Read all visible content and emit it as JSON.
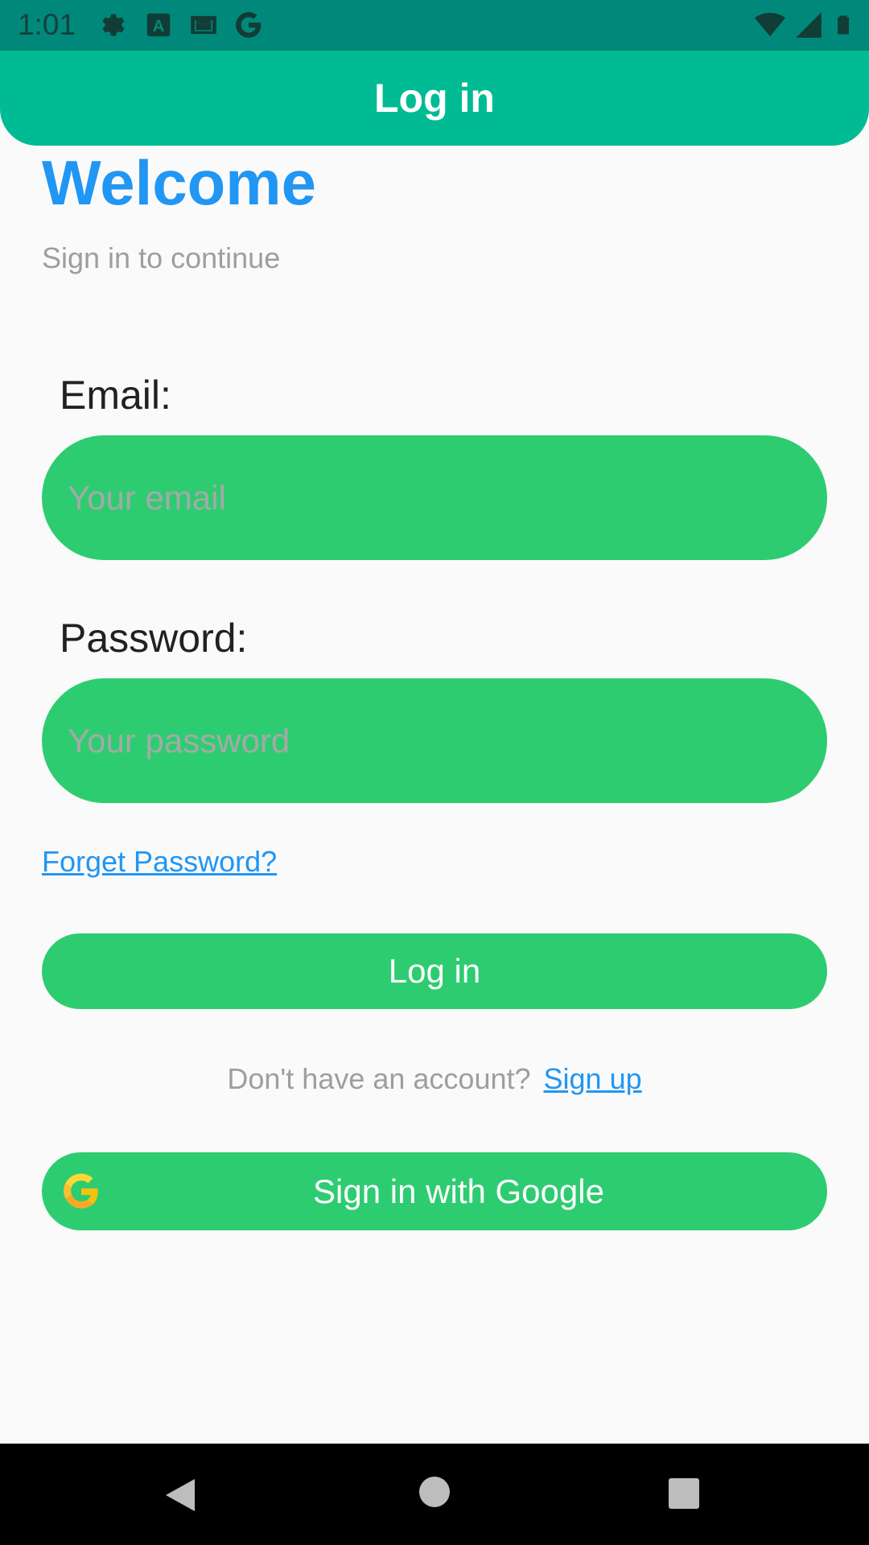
{
  "status_bar": {
    "time": "1:01",
    "left_icons": [
      "gear-icon",
      "a-icon",
      "gmail-icon",
      "google-icon"
    ],
    "right_icons": [
      "wifi-icon",
      "signal-icon",
      "battery-icon"
    ]
  },
  "app_bar": {
    "title": "Log in",
    "color": "#00bb93"
  },
  "header": {
    "title": "Welcome",
    "subtitle": "Sign in to continue",
    "title_color": "#2196f3"
  },
  "form": {
    "email_label": "Email:",
    "email_placeholder": "Your email",
    "email_value": "",
    "password_label": "Password:",
    "password_placeholder": "Your password",
    "password_value": "",
    "forget_password": "Forget Password?",
    "login_button": "Log in",
    "field_color": "#2ecc71"
  },
  "signup": {
    "question": "Don't have an account?",
    "link": "Sign up"
  },
  "google": {
    "label": "Sign in with Google",
    "icon": "google-g-icon"
  },
  "nav_bar": {
    "buttons": [
      "back-icon",
      "home-icon",
      "recents-icon"
    ]
  }
}
